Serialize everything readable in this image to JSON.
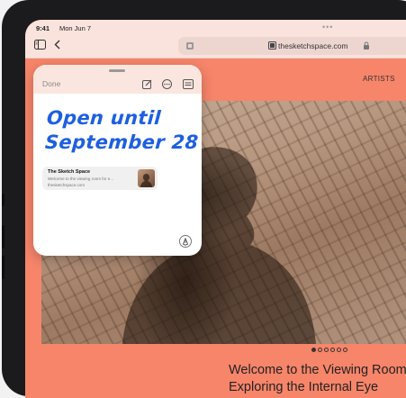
{
  "status": {
    "time": "9:41",
    "date": "Mon Jun 7",
    "multitask": "•••"
  },
  "toolbar": {
    "sidebar_icon": "sidebar-icon",
    "back_icon": "chevron-left-icon",
    "address_text": "thesketchspace.com",
    "page_icon": "page-icon",
    "lock_icon": "lock-icon"
  },
  "site": {
    "nav_item": "ARTISTS",
    "nav_item_cut": "I",
    "headline_1": "Welcome to the Viewing Room f",
    "headline_2": "Exploring the Internal Eye"
  },
  "carousel": {
    "count": 6,
    "active_index": 0
  },
  "quick_note": {
    "done_label": "Done",
    "compose_icon": "compose-icon",
    "more_icon": "more-icon",
    "notes_icon": "notes-list-icon",
    "handwriting_line1": "Open until",
    "handwriting_line2": "September 28",
    "link_title": "The Sketch Space",
    "link_desc": "Welcome to the viewing room for e...",
    "link_url": "thesketchspace.com",
    "pen_icon": "markup-pen-icon"
  },
  "colors": {
    "accent": "#f7856a",
    "handwriting": "#1d5fe0",
    "device": "#1b1b1d"
  }
}
